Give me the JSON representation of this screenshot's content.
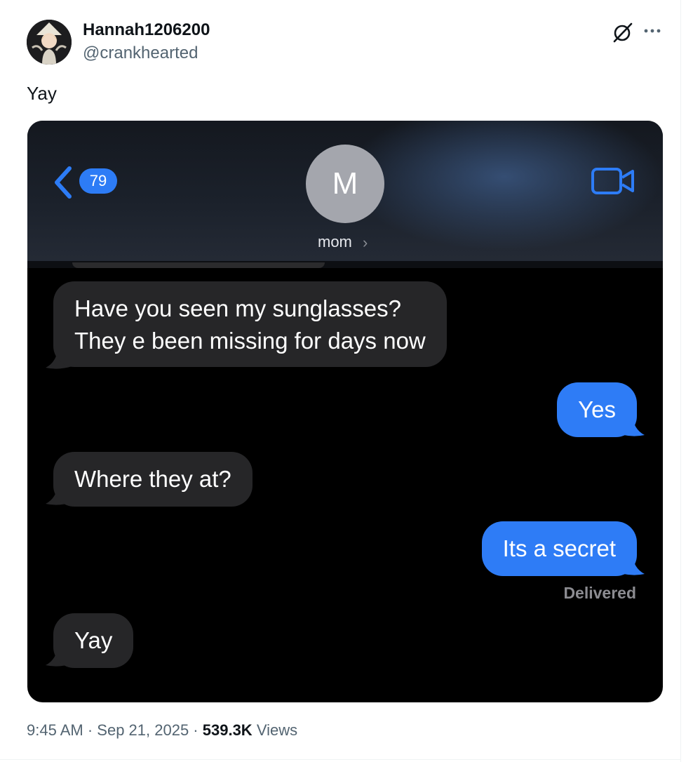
{
  "post": {
    "display_name": "Hannah1206200",
    "handle": "@crankhearted",
    "text": "Yay",
    "time": "9:45 AM",
    "date": "Sep 21, 2025",
    "views_count": "539.3K",
    "views_label": "Views",
    "separator": " · "
  },
  "conversation": {
    "back_count": "79",
    "contact_initial": "M",
    "contact_name": "mom",
    "contact_chevron": "›",
    "messages": [
      {
        "from": "them",
        "text": "Have you seen my sunglasses?\nThey e been missing for days now"
      },
      {
        "from": "me",
        "text": "Yes"
      },
      {
        "from": "them",
        "text": "Where they at?"
      },
      {
        "from": "me",
        "text": "Its a secret"
      },
      {
        "from": "them",
        "text": "Yay"
      }
    ],
    "delivered_label": "Delivered"
  },
  "colors": {
    "imessage_blue": "#2e7cf6",
    "incoming_bubble": "#262628",
    "link_blue": "#2d7cf6",
    "secondary_text": "#536471"
  },
  "icons": [
    "grok-icon",
    "more-icon",
    "back-chevron-icon",
    "video-call-icon"
  ]
}
